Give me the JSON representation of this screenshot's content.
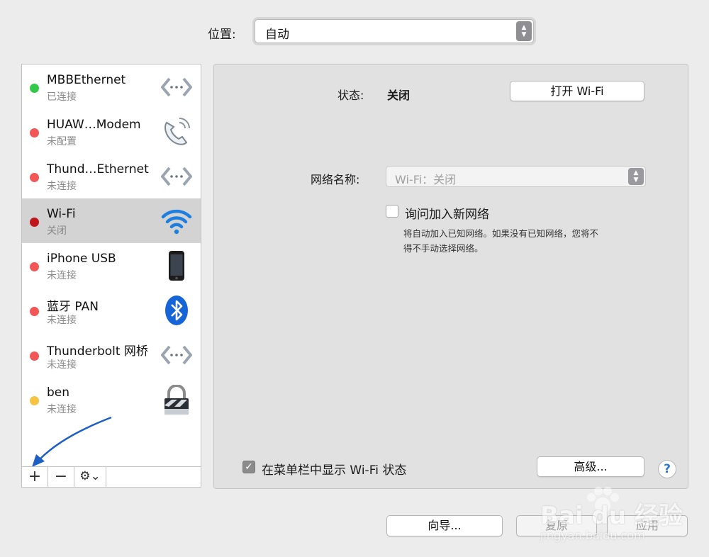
{
  "location": {
    "label": "位置:",
    "value": "自动"
  },
  "services": [
    {
      "name": "MBBEthernet",
      "status": "已连接",
      "dot_color": "#34c84a",
      "icon": "ethernet-icon"
    },
    {
      "name": "HUAW…Modem",
      "status": "未配置",
      "dot_color": "#f25656",
      "icon": "phone-modem-icon"
    },
    {
      "name": "Thund…Ethernet",
      "status": "未连接",
      "dot_color": "#f25656",
      "icon": "ethernet-icon"
    },
    {
      "name": "Wi-Fi",
      "status": "关闭",
      "dot_color": "#c0151b",
      "icon": "wifi-icon",
      "selected": true
    },
    {
      "name": "iPhone USB",
      "status": "未连接",
      "dot_color": "#f25656",
      "icon": "iphone-icon"
    },
    {
      "name": "蓝牙 PAN",
      "status": "未连接",
      "dot_color": "#f25656",
      "icon": "bluetooth-icon"
    },
    {
      "name": "Thunderbolt 网桥",
      "status": "未连接",
      "dot_color": "#f25656",
      "icon": "ethernet-icon"
    },
    {
      "name": "ben",
      "status": "未连接",
      "dot_color": "#f6c343",
      "icon": "lock-icon"
    }
  ],
  "sidebar_toolbar": {
    "add": "+",
    "remove": "−",
    "gear": "⚙︎⌄"
  },
  "panel": {
    "status_label": "状态:",
    "status_value": "关闭",
    "turn_on_button": "打开 Wi-Fi",
    "network_name_label": "网络名称:",
    "network_name_value": "Wi-Fi：关闭",
    "ask_join_label": "询问加入新网络",
    "ask_join_description_line1": "将自动加入已知网络。如果没有已知网络，您将不",
    "ask_join_description_line2": "得不手动选择网络。",
    "show_in_menubar_label": "在菜单栏中显示 Wi-Fi 状态",
    "advanced_button": "高级...",
    "help_button": "?"
  },
  "footer": {
    "assistant_button": "向导...",
    "revert_button": "复原",
    "apply_button": "应用"
  },
  "watermark": {
    "brand": "Bai du 经验",
    "url": "jingyan.baidu.com"
  },
  "colors": {
    "selected_row": "#d3d3d3",
    "annotation_arrow": "#1d5fc4",
    "window_bg": "#ececec"
  }
}
